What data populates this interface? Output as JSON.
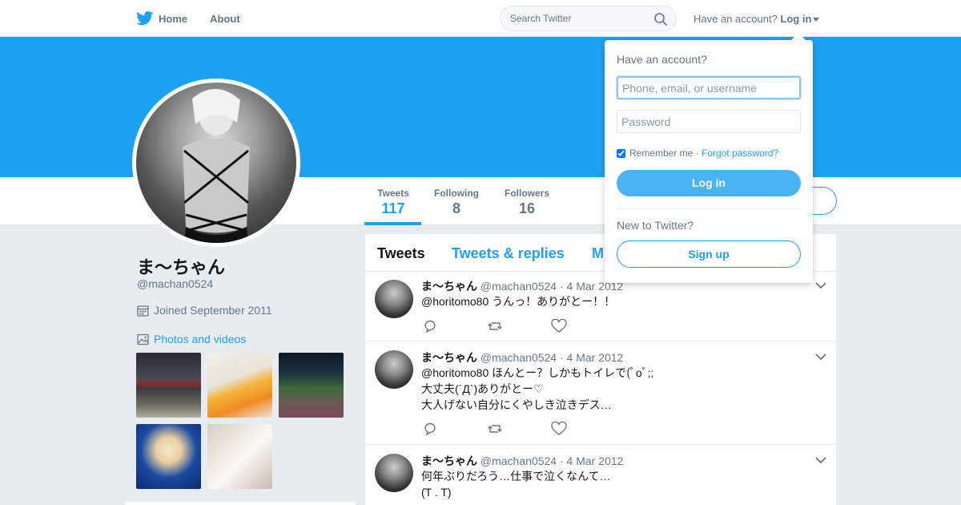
{
  "nav": {
    "home_label": "Home",
    "about_label": "About",
    "search_placeholder": "Search Twitter",
    "account_prompt": "Have an account?",
    "login_label": "Log in"
  },
  "profile": {
    "name": "ま〜ちゃん",
    "handle": "@machan0524",
    "joined": "Joined September 2011",
    "photos_label": "Photos and videos",
    "stats": [
      {
        "label": "Tweets",
        "value": "117"
      },
      {
        "label": "Following",
        "value": "8"
      },
      {
        "label": "Followers",
        "value": "16"
      }
    ]
  },
  "timeline": {
    "tabs": [
      "Tweets",
      "Tweets & replies",
      "M"
    ],
    "tweets": [
      {
        "name": "ま〜ちゃん",
        "handle": "@machan0524",
        "date": "4 Mar 2012",
        "text": "@horitomo80 うんっ！ありがとー！！"
      },
      {
        "name": "ま〜ちゃん",
        "handle": "@machan0524",
        "date": "4 Mar 2012",
        "text": "@horitomo80 ほんとー？しかもトイレで(ﾟoﾟ;;\n大丈夫(´Д`)ありがとー♡\n大人げない自分にくやしき泣きデス…"
      },
      {
        "name": "ま〜ちゃん",
        "handle": "@machan0524",
        "date": "4 Mar 2012",
        "text": "何年ぶりだろう…仕事で泣くなんて…\n(T . T)"
      }
    ]
  },
  "login_dropdown": {
    "title": "Have an account?",
    "username_placeholder": "Phone, email, or username",
    "password_placeholder": "Password",
    "remember_label": "Remember me",
    "separator": " · ",
    "forgot_label": "Forgot password?",
    "login_button": "Log in",
    "new_prompt": "New to Twitter?",
    "signup_button": "Sign up"
  },
  "colors": {
    "brand": "#1da1f2",
    "banner": "#1da1f2",
    "login_button": "#4ab3f4",
    "background": "#e6ecf0"
  }
}
